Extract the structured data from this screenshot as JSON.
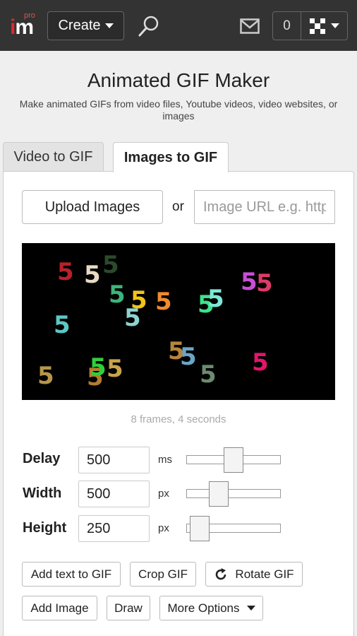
{
  "topbar": {
    "logo_superscript": "pro",
    "logo_text": "im",
    "create_label": "Create",
    "notification_count": "0"
  },
  "header": {
    "title": "Animated GIF Maker",
    "subtitle": "Make animated GIFs from video files, Youtube videos, video websites, or images"
  },
  "tabs": [
    {
      "label": "Video to GIF",
      "active": false
    },
    {
      "label": "Images to GIF",
      "active": true
    }
  ],
  "upload": {
    "button_label": "Upload Images",
    "or_label": "or",
    "url_placeholder": "Image URL e.g. https://"
  },
  "preview": {
    "digit": "5",
    "digits": [
      {
        "color": "#b7222b"
      },
      {
        "color": "#e9d9c2"
      },
      {
        "color": "#2a4a2c"
      },
      {
        "color": "#3cb47a"
      },
      {
        "color": "#f2c417"
      },
      {
        "color": "#ef8a2e"
      },
      {
        "color": "#3be28a"
      },
      {
        "color": "#7de7d8"
      },
      {
        "color": "#c84fd8"
      },
      {
        "color": "#e03a6a"
      },
      {
        "color": "#5bc7c3"
      },
      {
        "color": "#8ed3d0"
      },
      {
        "color": "#b5964a"
      },
      {
        "color": "#b47d2e"
      },
      {
        "color": "#c9a24a"
      },
      {
        "color": "#2fcf3b"
      },
      {
        "color": "#b7853a"
      },
      {
        "color": "#6aa6c7"
      },
      {
        "color": "#6b8c6e"
      },
      {
        "color": "#e3156a"
      }
    ],
    "frames_info": "8 frames, 4 seconds"
  },
  "controls": {
    "delay": {
      "label": "Delay",
      "value": "500",
      "unit": "ms",
      "level": 0.5
    },
    "width": {
      "label": "Width",
      "value": "500",
      "unit": "px",
      "level": 0.3
    },
    "height": {
      "label": "Height",
      "value": "250",
      "unit": "px",
      "level": 0.05
    }
  },
  "actions": {
    "add_text": "Add text to GIF",
    "crop": "Crop GIF",
    "rotate": "Rotate GIF",
    "add_image": "Add Image",
    "draw": "Draw",
    "more_options": "More Options"
  },
  "icons": {
    "search": "search-icon",
    "mail": "mail-icon",
    "user_menu": "grid-avatar-icon",
    "rotate": "rotate-icon"
  },
  "colors": {
    "topbar": "#333333",
    "brand_red": "#e0262e"
  }
}
